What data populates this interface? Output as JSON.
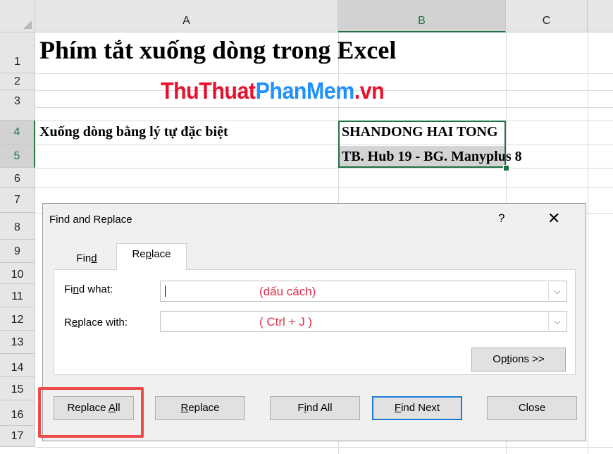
{
  "sheet": {
    "columns": [
      "A",
      "B",
      "C"
    ],
    "rows": [
      "1",
      "2",
      "3",
      "4",
      "5",
      "6",
      "7",
      "8",
      "9",
      "10",
      "11",
      "12",
      "13",
      "14",
      "15",
      "16",
      "17"
    ],
    "cells": {
      "a1": "Phím tắt xuống dòng trong Excel",
      "a2_part1": "ThuThuat",
      "a2_part2": "PhanMem",
      "a2_part3": ".vn",
      "a4": "Xuống dòng bằng lý tự đặc biệt",
      "b4": "SHANDONG HAI TONG",
      "b5": "TB. Hub 19 - BG. Manyplus 8"
    }
  },
  "dialog": {
    "title": "Find and Replace",
    "help": "?",
    "close": "✕",
    "tabs": {
      "find": {
        "pre": "Fin",
        "key": "d",
        "post": ""
      },
      "replace": {
        "pre": "Re",
        "key": "p",
        "post": "lace"
      }
    },
    "find_what": {
      "pre": "Fi",
      "key": "n",
      "post": "d what:",
      "hint": "(dấu cách)"
    },
    "replace_with": {
      "pre": "R",
      "key": "e",
      "post": "place with:",
      "hint": "( Ctrl + J )"
    },
    "buttons": {
      "options": {
        "pre": "Op",
        "key": "t",
        "post": "ions >>"
      },
      "replace_all": {
        "pre": "Replace ",
        "key": "A",
        "post": "ll"
      },
      "replace": {
        "pre": "",
        "key": "R",
        "post": "eplace"
      },
      "find_all": {
        "pre": "F",
        "key": "i",
        "post": "nd All"
      },
      "find_next": {
        "pre": "",
        "key": "F",
        "post": "ind Next"
      },
      "close": {
        "pre": "Close",
        "key": "",
        "post": ""
      }
    }
  },
  "colors": {
    "excel_green": "#217346",
    "brand_red": "#e8112d",
    "brand_blue": "#1e90ff",
    "annotation_red": "#ee4b4b",
    "hint_red": "#e0304a"
  },
  "icons": [
    "help-icon",
    "close-icon",
    "chevron-down-icon"
  ]
}
